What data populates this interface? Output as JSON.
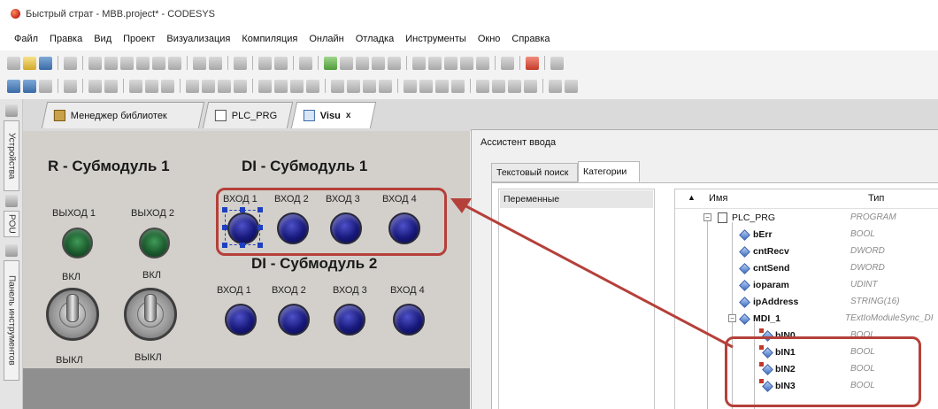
{
  "window": {
    "title": "Быстрый страт - MBB.project* - CODESYS"
  },
  "menu": [
    "Файл",
    "Правка",
    "Вид",
    "Проект",
    "Визуализация",
    "Компиляция",
    "Онлайн",
    "Отладка",
    "Инструменты",
    "Окно",
    "Справка"
  ],
  "left_panel": {
    "tab_devices": "Устройства",
    "tab_pou": "POU",
    "tab_toolbox": "Панель инструментов"
  },
  "tabs": [
    {
      "label": "Менеджер библиотек"
    },
    {
      "label": "PLC_PRG"
    },
    {
      "label": "Visu",
      "close": "x"
    }
  ],
  "visu": {
    "r_title": "R - Субмодуль 1",
    "di1_title": "DI - Субмодуль 1",
    "di2_title": "DI - Субмодуль 2",
    "outputs": [
      "ВЫХОД 1",
      "ВЫХОД 2"
    ],
    "on_label": "ВКЛ",
    "off_label": "ВЫКЛ",
    "inputs": [
      "ВХОД 1",
      "ВХОД 2",
      "ВХОД 3",
      "ВХОД 4"
    ]
  },
  "dialog": {
    "title": "Ассистент ввода",
    "tab_text_search": "Текстовый поиск",
    "tab_categories": "Категории",
    "category": "Переменные",
    "col_name": "Имя",
    "col_type": "Тип",
    "tree": [
      {
        "name": "PLC_PRG",
        "type": "PROGRAM"
      },
      {
        "name": "bErr",
        "type": "BOOL"
      },
      {
        "name": "cntRecv",
        "type": "DWORD"
      },
      {
        "name": "cntSend",
        "type": "DWORD"
      },
      {
        "name": "ioparam",
        "type": "UDINT"
      },
      {
        "name": "ipAddress",
        "type": "STRING(16)"
      },
      {
        "name": "MDI_1",
        "type": "TExtIoModuleSync_DI"
      },
      {
        "name": "bIN0",
        "type": "BOOL"
      },
      {
        "name": "bIN1",
        "type": "BOOL"
      },
      {
        "name": "bIN2",
        "type": "BOOL"
      },
      {
        "name": "bIN3",
        "type": "BOOL"
      }
    ]
  },
  "colors": {
    "highlight": "#b5403a",
    "canvas": "#d3d0cb",
    "lamp_green": "#1b5a2d",
    "lamp_blue": "#17187a"
  }
}
